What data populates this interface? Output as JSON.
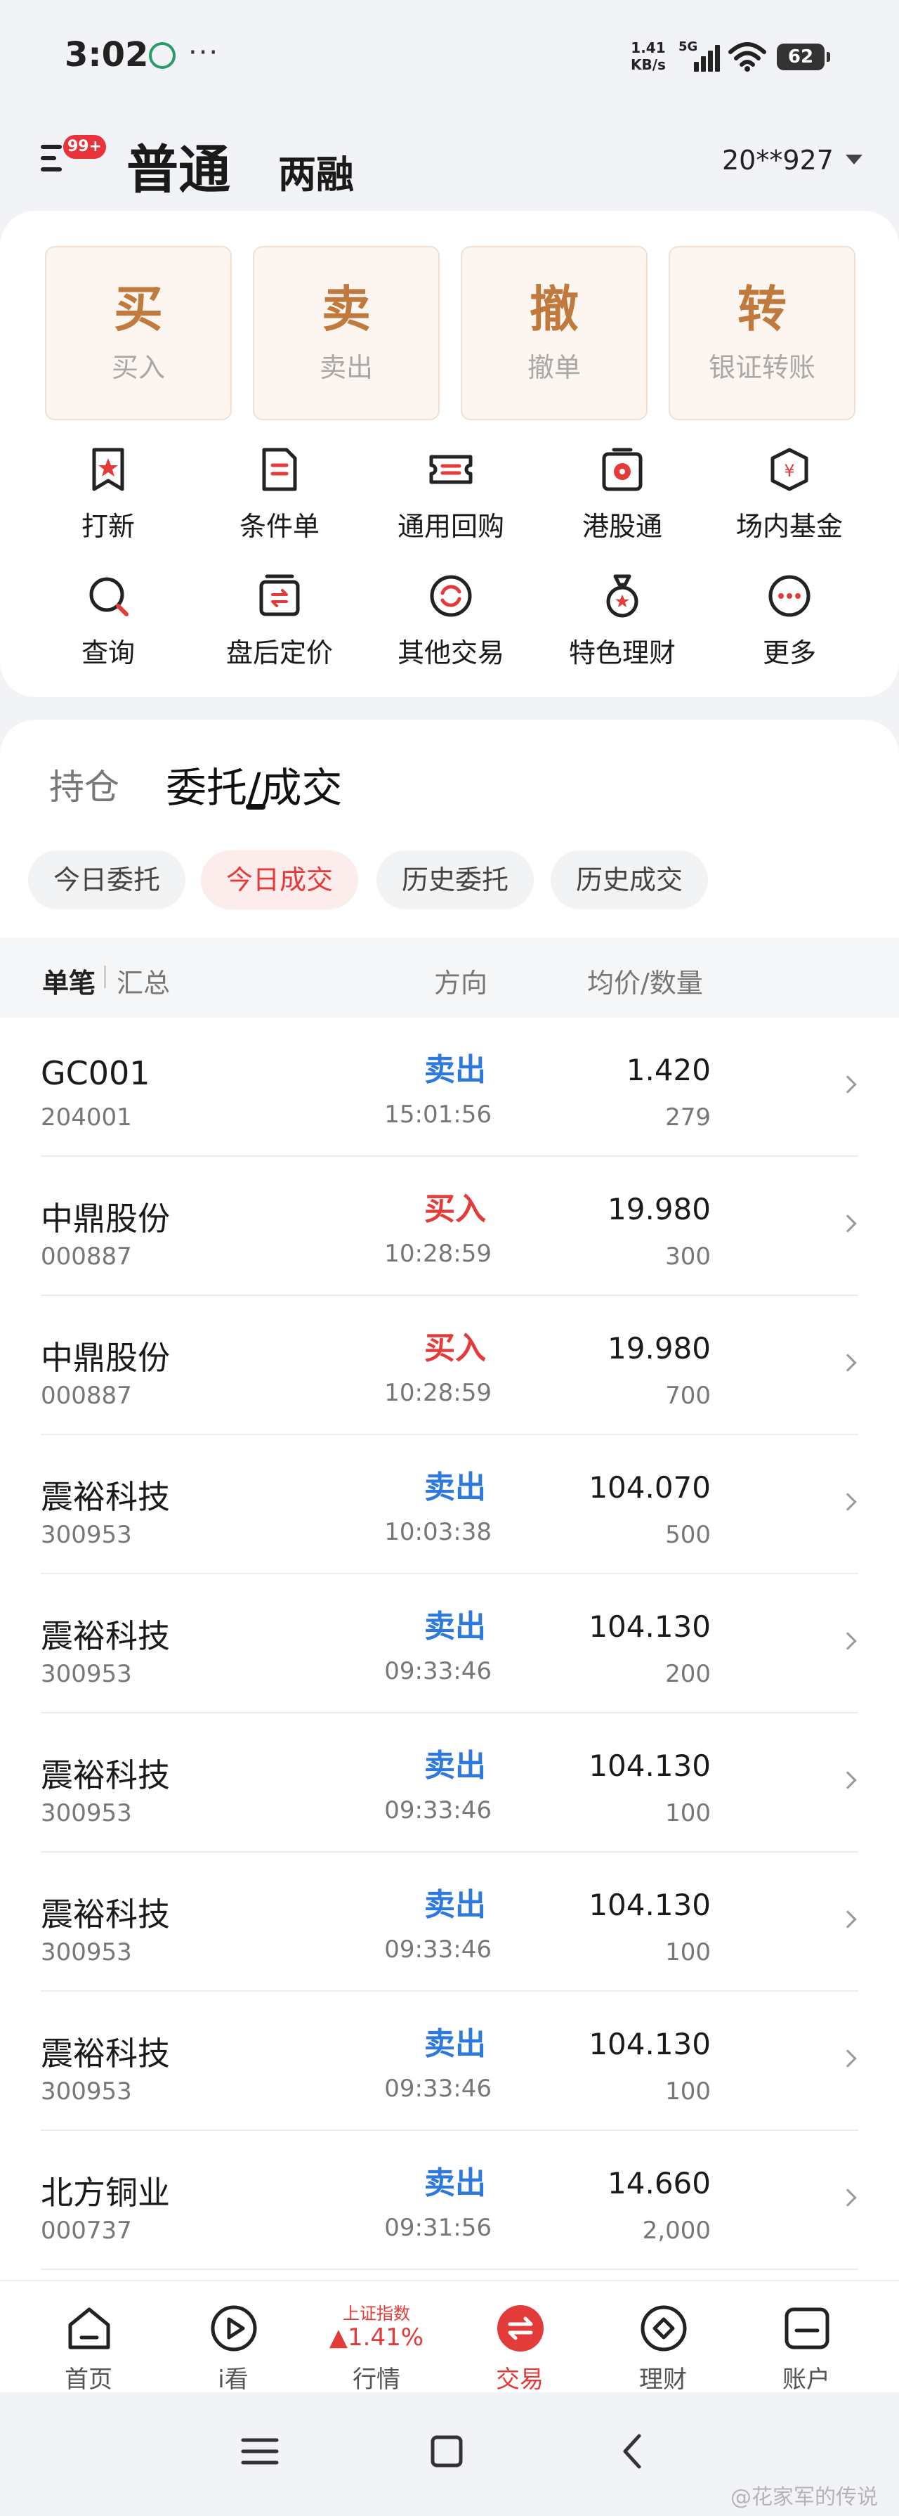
{
  "status_bar": {
    "time": "3:02",
    "net_speed_value": "1.41",
    "net_speed_unit": "KB/s",
    "signal_type": "5G",
    "battery": "62"
  },
  "header": {
    "menu_badge": "99+",
    "mode_main": "普通",
    "mode_sub": "两融",
    "account": "20**927"
  },
  "actions": [
    {
      "main": "买",
      "sub": "买入"
    },
    {
      "main": "卖",
      "sub": "卖出"
    },
    {
      "main": "撤",
      "sub": "撤单"
    },
    {
      "main": "转",
      "sub": "银证转账"
    }
  ],
  "grid_items": [
    {
      "label": "打新",
      "icon": "new-stock-icon"
    },
    {
      "label": "条件单",
      "icon": "condition-order-icon"
    },
    {
      "label": "通用回购",
      "icon": "repo-icon"
    },
    {
      "label": "港股通",
      "icon": "hk-connect-icon"
    },
    {
      "label": "场内基金",
      "icon": "fund-icon"
    },
    {
      "label": "查询",
      "icon": "query-icon"
    },
    {
      "label": "盘后定价",
      "icon": "after-hours-icon"
    },
    {
      "label": "其他交易",
      "icon": "other-trade-icon"
    },
    {
      "label": "特色理财",
      "icon": "wealth-icon"
    },
    {
      "label": "更多",
      "icon": "more-icon"
    }
  ],
  "panel_tabs": {
    "hold": "持仓",
    "entrust": "委托/成交"
  },
  "filter_chips": [
    "今日委托",
    "今日成交",
    "历史委托",
    "历史成交"
  ],
  "active_chip": "今日成交",
  "table_header": {
    "single": "单笔",
    "summary": "汇总",
    "direction": "方向",
    "price_qty": "均价/数量"
  },
  "trades": [
    {
      "name": "GC001",
      "code": "204001",
      "direction": "卖出",
      "side": "sell",
      "time": "15:01:56",
      "price": "1.420",
      "qty": "279"
    },
    {
      "name": "中鼎股份",
      "code": "000887",
      "direction": "买入",
      "side": "buy",
      "time": "10:28:59",
      "price": "19.980",
      "qty": "300"
    },
    {
      "name": "中鼎股份",
      "code": "000887",
      "direction": "买入",
      "side": "buy",
      "time": "10:28:59",
      "price": "19.980",
      "qty": "700"
    },
    {
      "name": "震裕科技",
      "code": "300953",
      "direction": "卖出",
      "side": "sell",
      "time": "10:03:38",
      "price": "104.070",
      "qty": "500"
    },
    {
      "name": "震裕科技",
      "code": "300953",
      "direction": "卖出",
      "side": "sell",
      "time": "09:33:46",
      "price": "104.130",
      "qty": "200"
    },
    {
      "name": "震裕科技",
      "code": "300953",
      "direction": "卖出",
      "side": "sell",
      "time": "09:33:46",
      "price": "104.130",
      "qty": "100"
    },
    {
      "name": "震裕科技",
      "code": "300953",
      "direction": "卖出",
      "side": "sell",
      "time": "09:33:46",
      "price": "104.130",
      "qty": "100"
    },
    {
      "name": "震裕科技",
      "code": "300953",
      "direction": "卖出",
      "side": "sell",
      "time": "09:33:46",
      "price": "104.130",
      "qty": "100"
    },
    {
      "name": "北方铜业",
      "code": "000737",
      "direction": "卖出",
      "side": "sell",
      "time": "09:31:56",
      "price": "14.660",
      "qty": "2,000"
    }
  ],
  "bottom_nav": {
    "home": "首页",
    "watch": "i看",
    "market_index": "上证指数",
    "market_change": "▲1.41%",
    "market": "行情",
    "trade": "交易",
    "wealth": "理财",
    "account": "账户"
  },
  "watermark": "@花家军的传说",
  "colors": {
    "accent": "#e33a3a",
    "sell": "#2e79de",
    "buy": "#e33a3a",
    "action_text": "#c07a3e"
  }
}
